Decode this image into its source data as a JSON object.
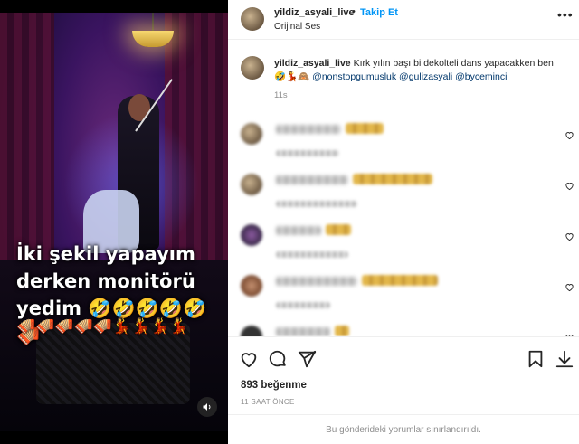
{
  "media": {
    "overlay_text": "İki şekil yapayım derken monitörü yedim 🤣🤣🤣🤣🤣🪗",
    "overlay_emojis": "🪗🪗🪗🪗🪗💃💃💃💃",
    "sound_icon": "speaker-icon"
  },
  "header": {
    "username": "yildiz_asyali_live",
    "separator": "•",
    "follow_label": "Takip Et",
    "subtitle": "Orijinal Ses",
    "more_icon": "•••"
  },
  "caption": {
    "username": "yildiz_asyali_live",
    "text": "Kırk yılın başı bi dekolteli dans yapacakken ben",
    "emojis": "🤣💃🙈",
    "mentions": [
      "@nonstopgumusluk",
      "@gulizasyali",
      "@byceminci"
    ],
    "time": "11s"
  },
  "comments": [
    {
      "has_emoji": true
    },
    {
      "has_emoji": true
    },
    {
      "has_emoji": true
    },
    {
      "has_emoji": true
    },
    {
      "has_emoji": true
    }
  ],
  "actions": {
    "icons": [
      "heart-icon",
      "comment-icon",
      "share-icon",
      "bookmark-icon",
      "download-icon"
    ],
    "likes": "893 beğenme",
    "time": "11 SAAT ÖNCE",
    "comments_limited": "Bu gönderideki yorumlar sınırlandırıldı."
  }
}
